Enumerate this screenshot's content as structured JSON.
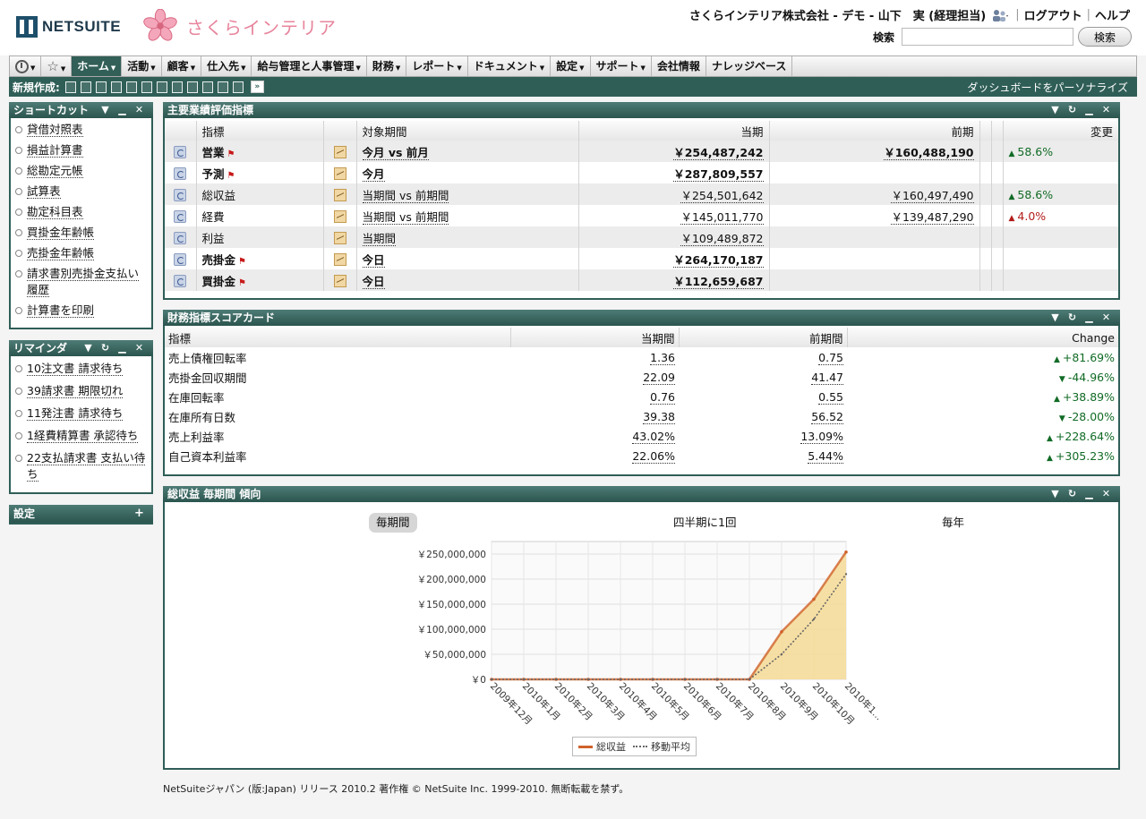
{
  "header": {
    "brand": "NETSUITE",
    "company_logo_text": "さくらインテリア",
    "user": "さくらインテリア株式会社 - デモ - 山下　実 (経理担当)",
    "logout": "ログアウト",
    "help": "ヘルプ",
    "search_label": "検索",
    "search_value": "",
    "search_button": "検索"
  },
  "nav": {
    "items": [
      {
        "label": "ホーム",
        "dropdown": true,
        "active": true
      },
      {
        "label": "活動",
        "dropdown": true
      },
      {
        "label": "顧客",
        "dropdown": true
      },
      {
        "label": "仕入先",
        "dropdown": true
      },
      {
        "label": "給与管理と人事管理",
        "dropdown": true
      },
      {
        "label": "財務",
        "dropdown": true
      },
      {
        "label": "レポート",
        "dropdown": true
      },
      {
        "label": "ドキュメント",
        "dropdown": true
      },
      {
        "label": "設定",
        "dropdown": true
      },
      {
        "label": "サポート",
        "dropdown": true
      },
      {
        "label": "会社情報",
        "dropdown": false
      },
      {
        "label": "ナレッジベース",
        "dropdown": false
      }
    ]
  },
  "toolbar": {
    "new_label": "新規作成:",
    "personalize": "ダッシュボードをパーソナライズ"
  },
  "shortcuts": {
    "title": "ショートカット",
    "items": [
      "貸借対照表",
      "損益計算書",
      "総勘定元帳",
      "試算表",
      "勘定科目表",
      "買掛金年齢帳",
      "売掛金年齢帳",
      "請求書別売掛金支払い履歴",
      "計算書を印刷"
    ]
  },
  "reminders": {
    "title": "リマインダ",
    "items": [
      "10注文書 請求待ち",
      "39請求書 期限切れ",
      "11発注書 請求待ち",
      "1経費精算書 承認待ち",
      "22支払請求書 支払い待ち"
    ]
  },
  "settings": {
    "title": "設定"
  },
  "kpi": {
    "title": "主要業績評価指標",
    "headers": {
      "indicator": "指標",
      "period": "対象期間",
      "current": "当期",
      "previous": "前期",
      "change": "変更"
    },
    "rows": [
      {
        "name": "営業",
        "bold": true,
        "flag": true,
        "period": "今月 vs 前月",
        "current": "￥254,487,242",
        "previous": "￥160,488,190",
        "change": "58.6%",
        "dir": "up"
      },
      {
        "name": "予測",
        "bold": true,
        "flag": true,
        "period": "今月",
        "current": "￥287,809,557",
        "previous": "",
        "change": "",
        "dir": ""
      },
      {
        "name": "総収益",
        "bold": false,
        "flag": false,
        "period": "当期間 vs 前期間",
        "current": "￥254,501,642",
        "previous": "￥160,497,490",
        "change": "58.6%",
        "dir": "up"
      },
      {
        "name": "経費",
        "bold": false,
        "flag": false,
        "period": "当期間 vs 前期間",
        "current": "￥145,011,770",
        "previous": "￥139,487,290",
        "change": "4.0%",
        "dir": "upred"
      },
      {
        "name": "利益",
        "bold": false,
        "flag": false,
        "period": "当期間",
        "current": "￥109,489,872",
        "previous": "",
        "change": "",
        "dir": ""
      },
      {
        "name": "売掛金",
        "bold": true,
        "flag": true,
        "period": "今日",
        "current": "￥264,170,187",
        "previous": "",
        "change": "",
        "dir": ""
      },
      {
        "name": "買掛金",
        "bold": true,
        "flag": true,
        "period": "今日",
        "current": "￥112,659,687",
        "previous": "",
        "change": "",
        "dir": ""
      }
    ]
  },
  "scorecard": {
    "title": "財務指標スコアカード",
    "headers": {
      "indicator": "指標",
      "current": "当期間",
      "previous": "前期間",
      "change": "Change"
    },
    "rows": [
      {
        "name": "売上債権回転率",
        "current": "1.36",
        "previous": "0.75",
        "change": "+81.69%",
        "dir": "up"
      },
      {
        "name": "売掛金回収期間",
        "current": "22.09",
        "previous": "41.47",
        "change": "-44.96%",
        "dir": "down"
      },
      {
        "name": "在庫回転率",
        "current": "0.76",
        "previous": "0.55",
        "change": "+38.89%",
        "dir": "up"
      },
      {
        "name": "在庫所有日数",
        "current": "39.38",
        "previous": "56.52",
        "change": "-28.00%",
        "dir": "down"
      },
      {
        "name": "売上利益率",
        "current": "43.02%",
        "previous": "13.09%",
        "change": "+228.64%",
        "dir": "up"
      },
      {
        "name": "自己資本利益率",
        "current": "22.06%",
        "previous": "5.44%",
        "change": "+305.23%",
        "dir": "up"
      }
    ]
  },
  "trend": {
    "title": "総収益 毎期間 傾向",
    "tabs": [
      {
        "label": "毎期間",
        "selected": true
      },
      {
        "label": "四半期に1回",
        "selected": false
      },
      {
        "label": "毎年",
        "selected": false
      }
    ]
  },
  "chart_data": {
    "type": "area",
    "categories": [
      "2009年12月",
      "2010年1月",
      "2010年2月",
      "2010年3月",
      "2010年4月",
      "2010年5月",
      "2010年6月",
      "2010年7月",
      "2010年8月",
      "2010年9月",
      "2010年10月",
      "2010年1..."
    ],
    "series": [
      {
        "name": "総収益",
        "values": [
          0,
          0,
          0,
          0,
          0,
          0,
          0,
          0,
          0,
          95000000,
          160000000,
          254000000
        ]
      },
      {
        "name": "移動平均",
        "values": [
          0,
          0,
          0,
          0,
          0,
          0,
          0,
          0,
          0,
          50000000,
          120000000,
          210000000
        ]
      }
    ],
    "y_ticks": [
      "￥0",
      "￥50,000,000",
      "￥100,000,000",
      "￥150,000,000",
      "￥200,000,000",
      "￥250,000,000"
    ],
    "ylim": [
      0,
      275000000
    ],
    "grid": true,
    "legend": "bottom",
    "colors": {
      "revenue": "#d0622b",
      "area": "#f5d994",
      "moving_avg": "#666666"
    }
  },
  "footer": "NetSuiteジャパン (版:Japan) リリース 2010.2 著作権 © NetSuite Inc. 1999-2010. 無断転載を禁ず。"
}
